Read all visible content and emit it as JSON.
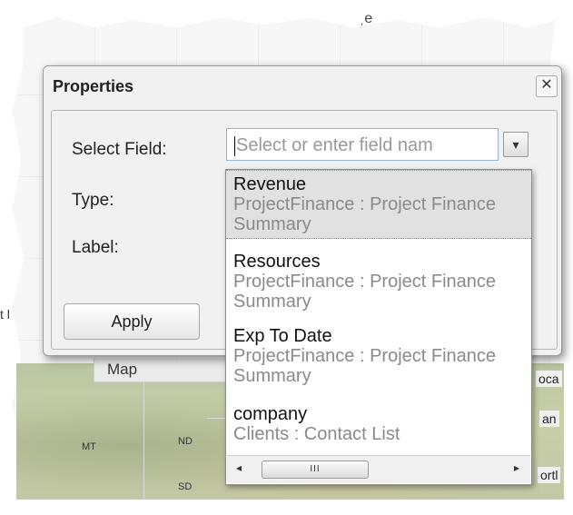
{
  "background": {
    "top_fragment": "ˌe",
    "left_fragment": "t l",
    "map_tab_label": "Map",
    "state_labels": [
      "MT",
      "ND",
      "SD"
    ],
    "right_fragments": [
      "oca",
      "an",
      "ortl"
    ]
  },
  "dialog": {
    "title": "Properties",
    "close_glyph": "✕",
    "labels": {
      "select_field": "Select Field:",
      "type": "Type:",
      "label": "Label:"
    },
    "apply_label": "Apply",
    "combo": {
      "placeholder": "Select or enter field nam",
      "arrow_glyph": "▾"
    },
    "dropdown": {
      "items": [
        {
          "name": "Revenue",
          "source": "ProjectFinance : Project Finance Summary",
          "selected": true
        },
        {
          "name": "Resources",
          "source": "ProjectFinance : Project Finance Summary",
          "selected": false
        },
        {
          "name": "Exp To Date",
          "source": "ProjectFinance : Project Finance Summary",
          "selected": false
        },
        {
          "name": "company",
          "source": "Clients : Contact List",
          "selected": false
        }
      ],
      "scroll_left": "◂",
      "scroll_thumb": "III",
      "scroll_right": "▸"
    }
  },
  "colors": {
    "dialog_bg": "#f1f1f1",
    "selected_item_bg": "#e1e1e1",
    "secondary_text": "#8a8a8a",
    "input_border": "#9ab4d6"
  }
}
